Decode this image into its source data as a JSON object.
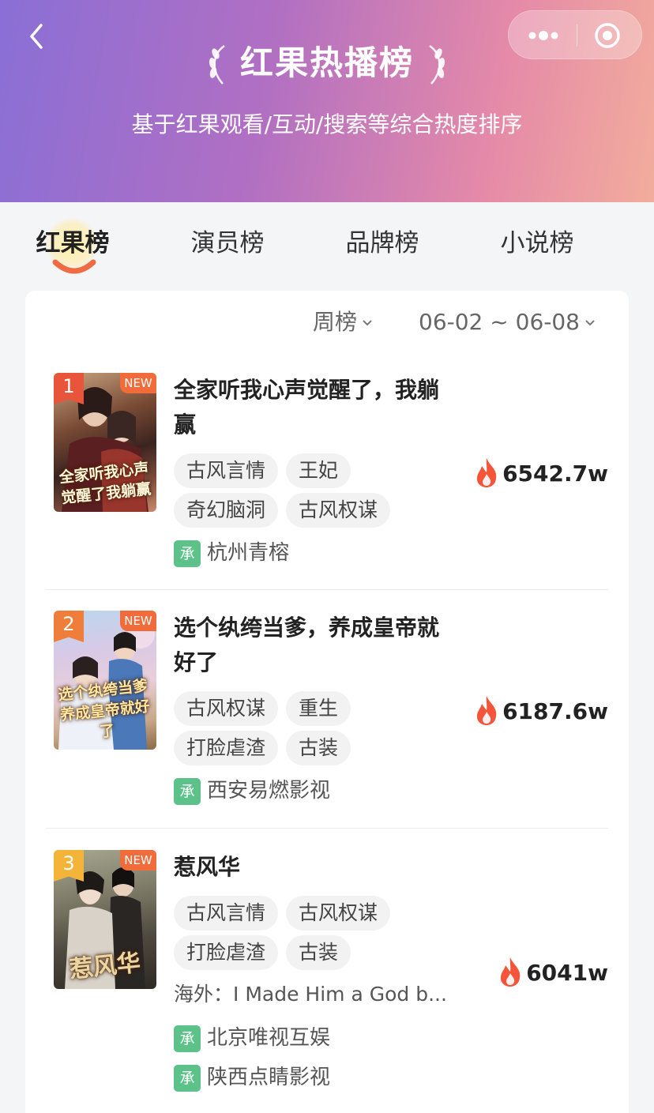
{
  "header": {
    "title": "红果热播榜",
    "subtitle": "基于红果观看/互动/搜索等综合热度排序"
  },
  "tabs": [
    {
      "label": "红果榜",
      "active": true
    },
    {
      "label": "演员榜",
      "active": false
    },
    {
      "label": "品牌榜",
      "active": false
    },
    {
      "label": "小说榜",
      "active": false
    }
  ],
  "filters": {
    "period": "周榜",
    "date_range": "06-02 ~ 06-08"
  },
  "ranking": [
    {
      "rank": "1",
      "rank_color": "#e8553a",
      "badge": "NEW",
      "name": "全家听我心声觉醒了，我躺赢",
      "poster_caption": "全家听我心声觉醒了我躺赢",
      "tags": [
        "古风言情",
        "王妃",
        "奇幻脑洞",
        "古风权谋"
      ],
      "heat": "6542.7w",
      "producers": [
        "杭州青榕"
      ]
    },
    {
      "rank": "2",
      "rank_color": "#ef7e3a",
      "badge": "NEW",
      "name": "选个纨绔当爹，养成皇帝就好了",
      "poster_caption": "选个纨绔当爹养成皇帝就好了",
      "tags": [
        "古风权谋",
        "重生",
        "打脸虐渣",
        "古装"
      ],
      "heat": "6187.6w",
      "producers": [
        "西安易燃影视"
      ]
    },
    {
      "rank": "3",
      "rank_color": "#f4b43a",
      "badge": "NEW",
      "name": "惹风华",
      "poster_caption": "惹风华",
      "tags": [
        "古风言情",
        "古风权谋",
        "打脸虐渣",
        "古装"
      ],
      "overseas": "海外：I Made Him a God b...",
      "heat": "6041w",
      "producers": [
        "北京唯视互娱",
        "陕西点睛影视"
      ]
    }
  ],
  "producer_mark": "承",
  "colors": {
    "accent": "#f06a42",
    "producer_mark": "#5cc28a",
    "new_badge": "#f26b3a"
  }
}
